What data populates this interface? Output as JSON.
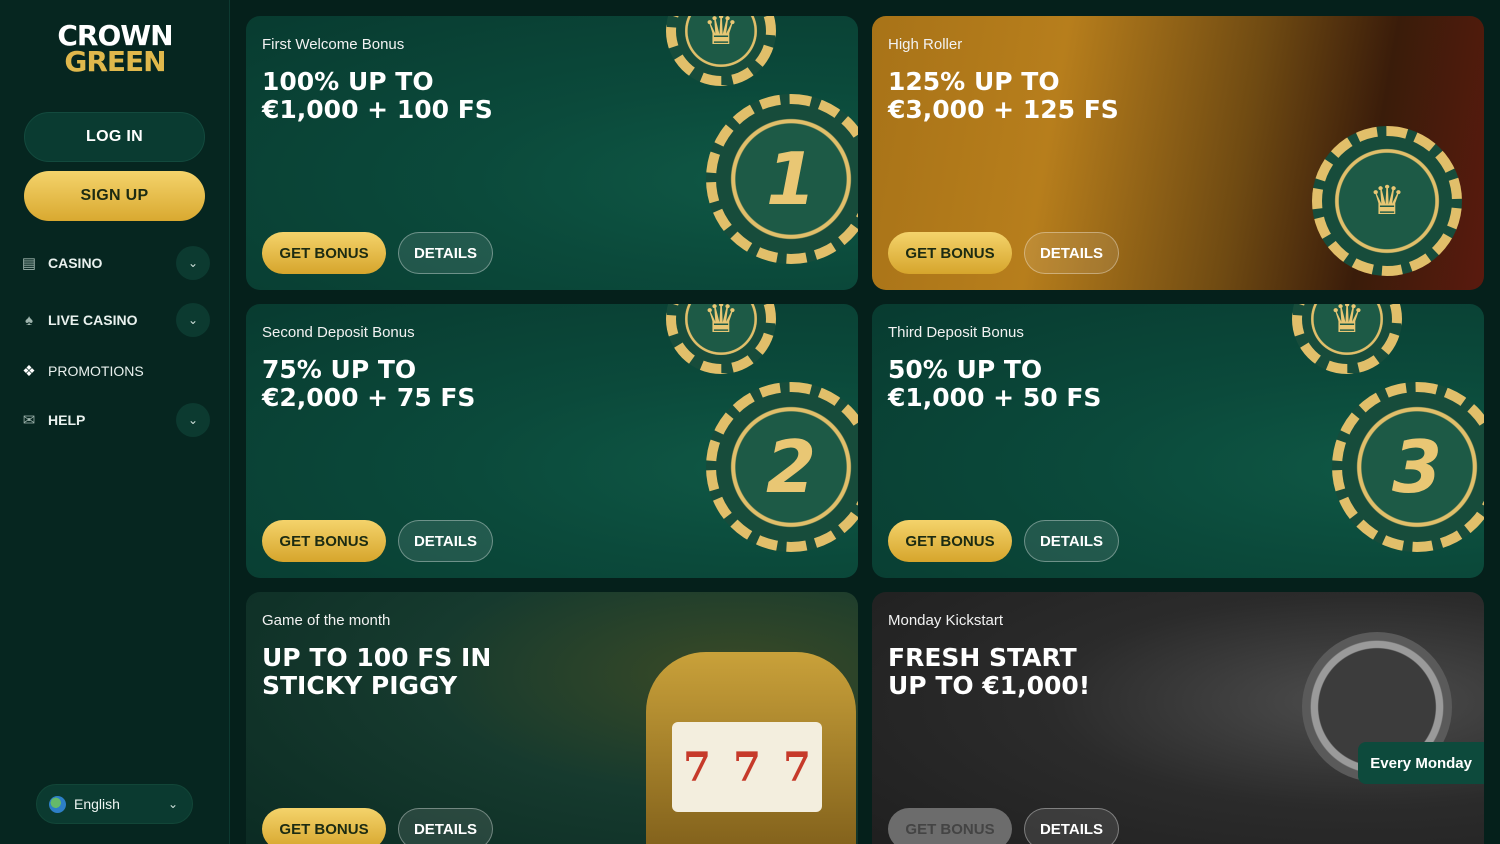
{
  "logo": {
    "line1": "CROWN",
    "line2": "GREEN"
  },
  "auth": {
    "login_label": "LOG IN",
    "signup_label": "SIGN UP"
  },
  "nav": {
    "items": [
      {
        "label": "CASINO",
        "icon": "casino-icon",
        "has_submenu": true
      },
      {
        "label": "LIVE CASINO",
        "icon": "spade-icon",
        "has_submenu": true
      },
      {
        "label": "PROMOTIONS",
        "icon": "gift-icon",
        "has_submenu": false
      },
      {
        "label": "HELP",
        "icon": "mail-icon",
        "has_submenu": true
      }
    ]
  },
  "language": {
    "label": "English",
    "icon": "globe-icon"
  },
  "promos": [
    {
      "subtitle": "First Welcome Bonus",
      "headline": "100% UP TO\n€1,000 + 100 FS",
      "get_label": "GET BONUS",
      "details_label": "DETAILS",
      "chip_number": "1"
    },
    {
      "subtitle": "High Roller",
      "headline": "125% UP TO\n€3,000 + 125 FS",
      "get_label": "GET BONUS",
      "details_label": "DETAILS"
    },
    {
      "subtitle": "Second Deposit Bonus",
      "headline": "75% UP TO\n€2,000 + 75 FS",
      "get_label": "GET BONUS",
      "details_label": "DETAILS",
      "chip_number": "2"
    },
    {
      "subtitle": "Third Deposit Bonus",
      "headline": "50% UP TO\n€1,000 + 50 FS",
      "get_label": "GET BONUS",
      "details_label": "DETAILS",
      "chip_number": "3"
    },
    {
      "subtitle": "Game of the month",
      "headline": "UP TO 100 FS IN\nSTICKY PIGGY",
      "get_label": "GET BONUS",
      "details_label": "DETAILS"
    },
    {
      "subtitle": "Monday Kickstart",
      "headline": "FRESH START\nUP TO €1,000!",
      "get_label": "GET BONUS",
      "details_label": "DETAILS",
      "badge": "Every Monday"
    }
  ],
  "colors": {
    "accent_gold": "#e0b84c",
    "bg": "#05201b",
    "card_green": "#0b4a3b"
  }
}
